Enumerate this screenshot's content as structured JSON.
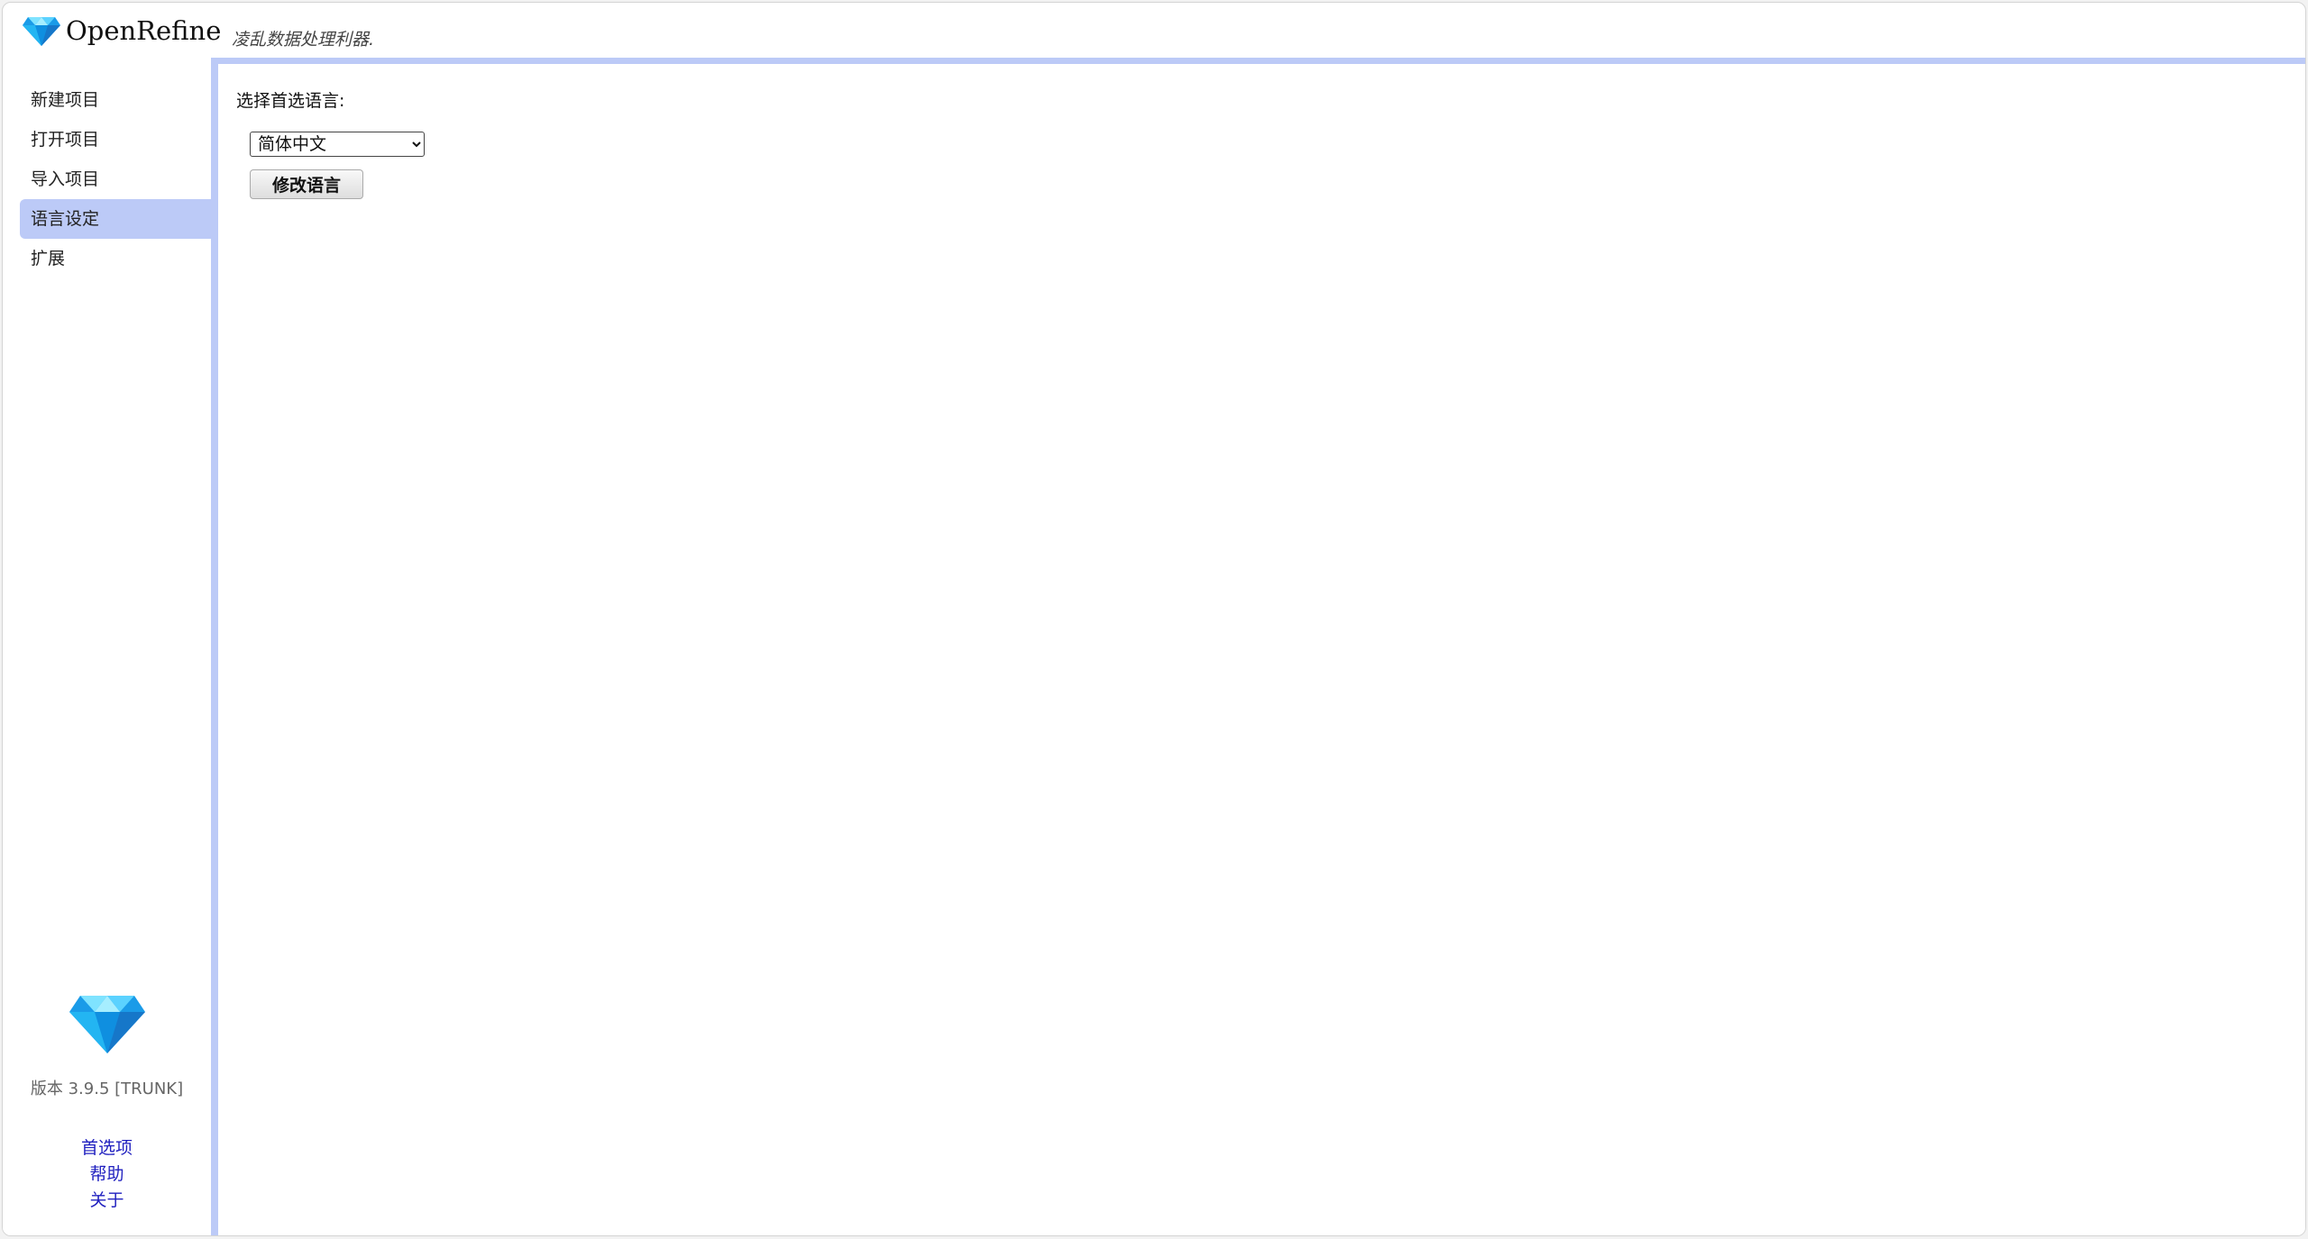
{
  "header": {
    "app_name": "OpenRefine",
    "tagline": "凌乱数据处理利器."
  },
  "sidebar": {
    "items": [
      {
        "label": "新建项目"
      },
      {
        "label": "打开项目"
      },
      {
        "label": "导入项目"
      },
      {
        "label": "语言设定",
        "selected": true
      },
      {
        "label": "扩展"
      }
    ],
    "version": "版本 3.9.5 [TRUNK]",
    "links": [
      {
        "label": "首选项"
      },
      {
        "label": "帮助"
      },
      {
        "label": "关于"
      }
    ]
  },
  "main": {
    "language_label": "选择首选语言:",
    "language_select": {
      "selected": "简体中文"
    },
    "change_button_label": "修改语言"
  },
  "colors": {
    "accent": "#bccaf7",
    "link": "#1f1fbf",
    "gem_light": "#4fd3ff",
    "gem_dark": "#1a8fe0"
  }
}
